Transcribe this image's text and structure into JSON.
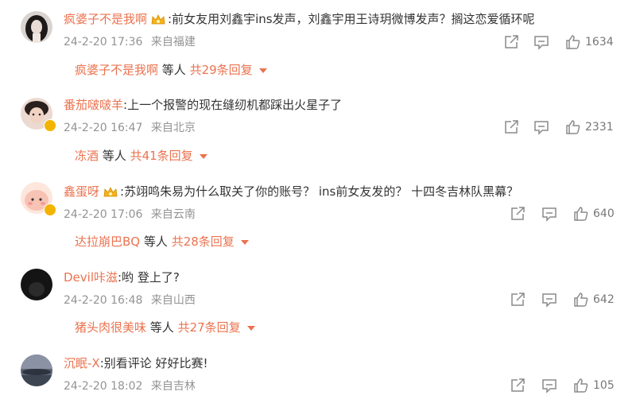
{
  "comments": [
    {
      "username": "疯婆子不是我啊",
      "has_crown": true,
      "text": ":前女友用刘鑫宇ins发声，刘鑫宇用王诗玥微博发声？搁这恋爱循环呢",
      "date": "24-2-20 17:36",
      "location": "来自福建",
      "likes": "1634",
      "reply_user": "疯婆子不是我啊",
      "reply_mid": "等人",
      "reply_count": "共29条回复"
    },
    {
      "username": "番茄啵啵羊",
      "has_crown": false,
      "text": ":上一个报警的现在缝纫机都踩出火星子了",
      "date": "24-2-20 16:47",
      "location": "来自北京",
      "likes": "2331",
      "reply_user": "冻酒",
      "reply_mid": "等人",
      "reply_count": "共41条回复"
    },
    {
      "username": "鑫蛋呀",
      "has_crown": true,
      "text": ":苏翊鸣朱易为什么取关了你的账号？ ins前女友发的？ 十四冬吉林队黑幕？",
      "date": "24-2-20 17:06",
      "location": "来自云南",
      "likes": "640",
      "reply_user": "达拉崩巴BQ",
      "reply_mid": "等人",
      "reply_count": "共28条回复"
    },
    {
      "username": "Devil咔滋",
      "has_crown": false,
      "text": ":哟 登上了?",
      "date": "24-2-20 16:48",
      "location": "来自山西",
      "likes": "642",
      "reply_user": "猪头肉很美味",
      "reply_mid": "等人",
      "reply_count": "共27条回复"
    },
    {
      "username": "沉眠-X",
      "has_crown": false,
      "text": ":别看评论 好好比赛!",
      "date": "24-2-20 18:02",
      "location": "来自吉林",
      "likes": "105"
    }
  ],
  "colors": {
    "username": "#eb7350",
    "text": "#333333",
    "meta": "#939393",
    "icon": "#8a8a8a"
  },
  "icons": [
    "share-icon",
    "comment-icon",
    "like-icon",
    "crown-badge-icon",
    "verified-badge-icon",
    "dropdown-caret-icon"
  ]
}
